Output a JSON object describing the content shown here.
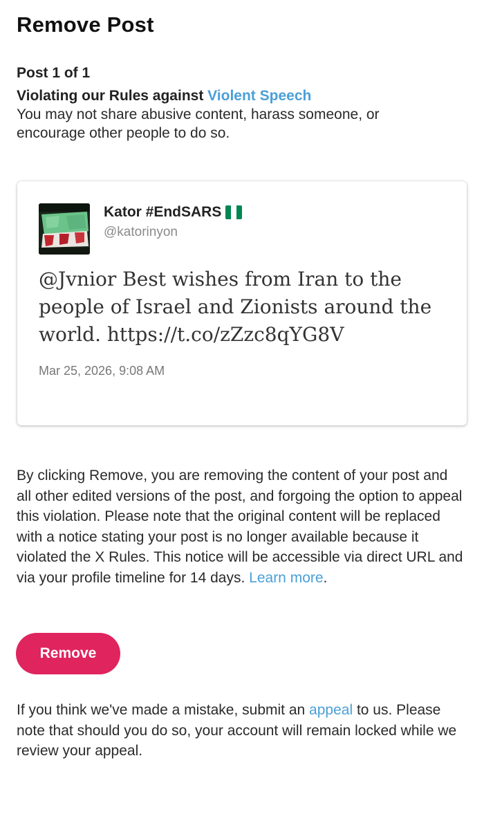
{
  "header": {
    "title": "Remove Post"
  },
  "violation": {
    "post_count": "Post 1 of 1",
    "rule_prefix": "Violating our Rules against ",
    "rule_link": "Violent Speech",
    "description": "You may not share abusive content, harass someone, or encourage other people to do so."
  },
  "post": {
    "author_name": "Kator #EndSARS",
    "flag_icon": "nigeria-flag",
    "handle": "@katorinyon",
    "text": "@Jvnior Best wishes from Iran to the people of Israel and Zionists around the world. https://t.co/zZzc8qYG8V",
    "timestamp": "Mar 25, 2026, 9:08 AM"
  },
  "notice": {
    "text": "By clicking Remove, you are removing the content of your post and all other edited versions of the post, and forgoing the option to appeal this violation. Please note that the original content will be replaced with a notice stating your post is no longer available because it violated the X Rules. This notice will be accessible via direct URL and via your profile timeline for 14 days. ",
    "learn_more": "Learn more",
    "end": "."
  },
  "actions": {
    "remove_label": "Remove"
  },
  "appeal": {
    "prefix": "If you think we've made a mistake, submit an ",
    "link": "appeal",
    "suffix": " to us. Please note that should you do so, your account will remain locked while we review your appeal."
  },
  "colors": {
    "accent_link": "#4a9fd8",
    "remove_button": "#e0245e",
    "flag_green": "#008751",
    "flag_white": "#ffffff"
  }
}
